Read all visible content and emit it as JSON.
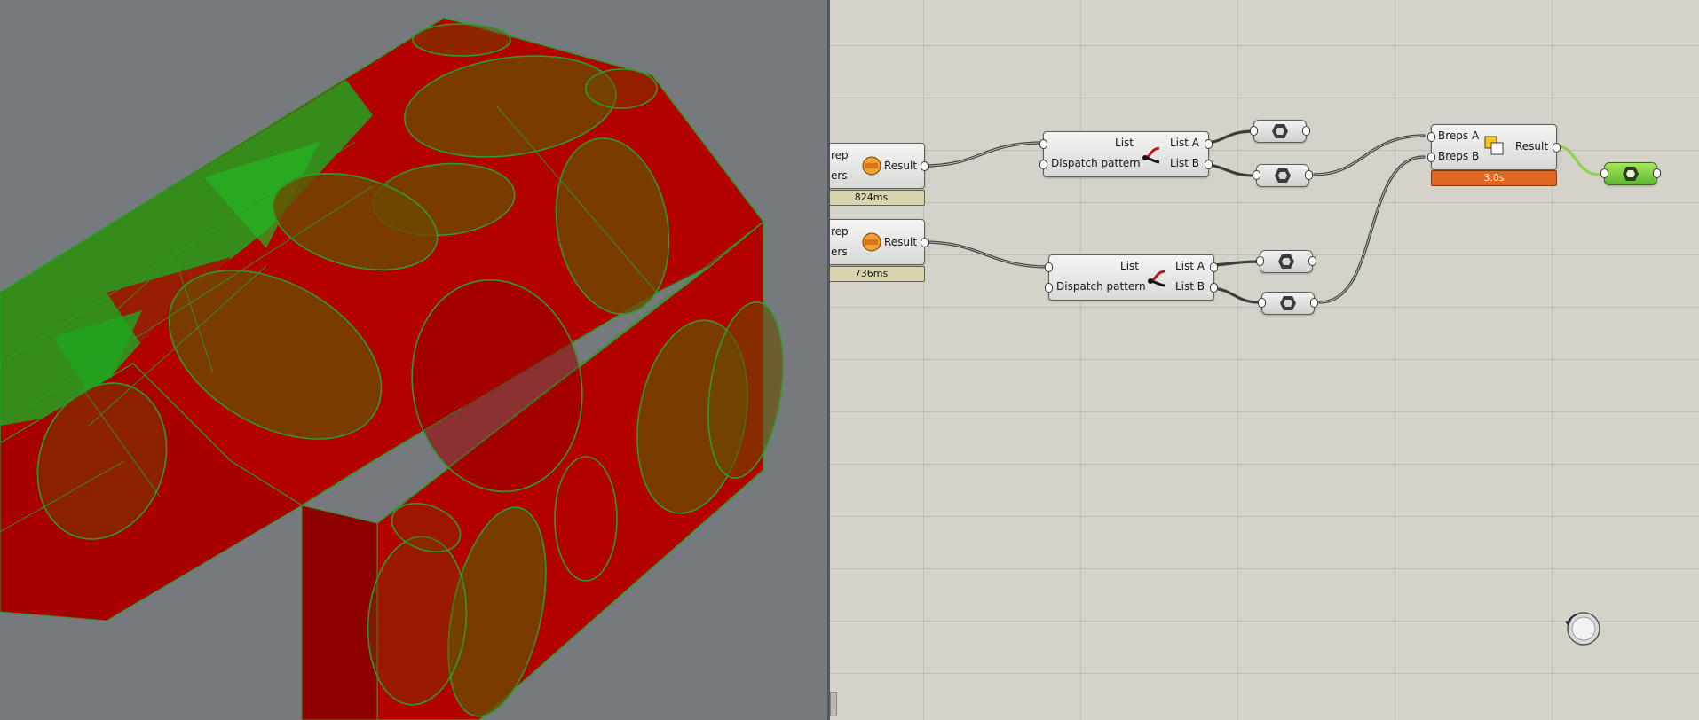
{
  "viewport": {
    "colors": {
      "background": "#767a7e",
      "mesh_red": "#b30000",
      "mesh_green": "#1fa51f",
      "overlap": "#6b4a00"
    }
  },
  "canvas": {
    "components": [
      {
        "name": "top-left-partial",
        "inputs": [
          "rep",
          "ers"
        ],
        "outputs": [
          "Result"
        ],
        "timer": "824ms"
      },
      {
        "name": "bottom-left-partial",
        "inputs": [
          "rep",
          "ers"
        ],
        "outputs": [
          "Result"
        ],
        "timer": "736ms"
      },
      {
        "name": "dispatch-top",
        "inputs": [
          "List",
          "Dispatch pattern"
        ],
        "outputs": [
          "List A",
          "List B"
        ]
      },
      {
        "name": "dispatch-bottom",
        "inputs": [
          "List",
          "Dispatch pattern"
        ],
        "outputs": [
          "List A",
          "List B"
        ]
      },
      {
        "name": "boolean-difference",
        "inputs": [
          "Breps A",
          "Breps B"
        ],
        "outputs": [
          "Result"
        ],
        "timer": "3.0s"
      }
    ],
    "colors": {
      "wire": "#3d3d3d",
      "wire_selected": "#8ed050",
      "timer_warn": "#e06622",
      "timer_normal": "#d8d4ad"
    },
    "icons": [
      "solid-union-icon",
      "dispatch-icon",
      "boolean-difference-icon",
      "brep-param-icon",
      "navigator-icon"
    ]
  }
}
